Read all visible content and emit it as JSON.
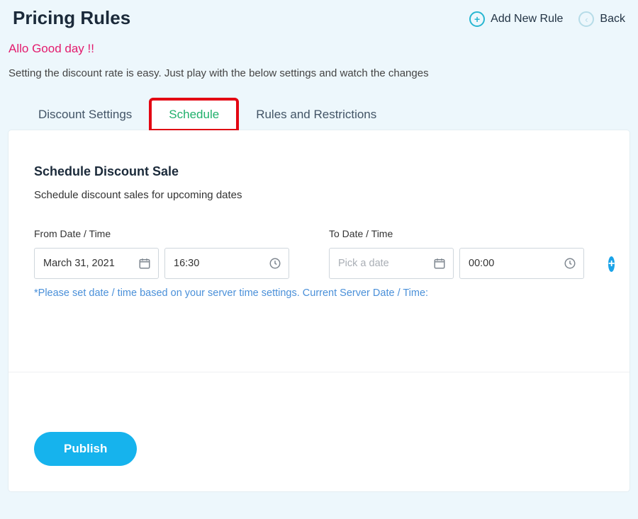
{
  "header": {
    "title": "Pricing Rules",
    "add_new_rule": "Add New Rule",
    "back": "Back"
  },
  "intro": {
    "greeting": "Allo Good day !!",
    "help_text": "Setting the discount rate is easy. Just play with the below settings and watch the changes"
  },
  "tabs": [
    {
      "label": "Discount Settings",
      "active": false
    },
    {
      "label": "Schedule",
      "active": true,
      "highlighted": true
    },
    {
      "label": "Rules and Restrictions",
      "active": false
    }
  ],
  "schedule": {
    "title": "Schedule Discount Sale",
    "description": "Schedule discount sales for upcoming dates",
    "from_label": "From Date / Time",
    "to_label": "To Date / Time",
    "from_date": "March 31, 2021",
    "from_time": "16:30",
    "to_date": "",
    "to_date_placeholder": "Pick a date",
    "to_time": "00:00",
    "note": "*Please set date / time based on your server time settings. Current Server Date / Time:"
  },
  "footer": {
    "publish": "Publish"
  }
}
